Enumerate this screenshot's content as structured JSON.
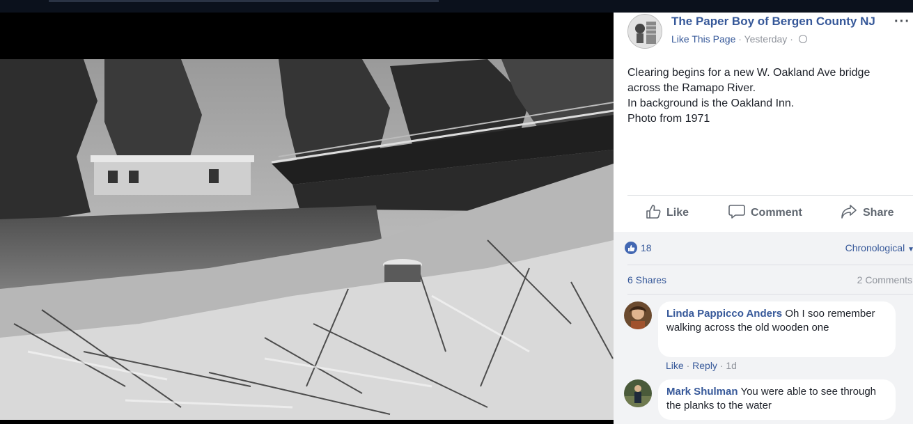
{
  "post": {
    "page_name": "The Paper Boy of Bergen County NJ",
    "like_page": "Like This Page",
    "separator": " · ",
    "time": "Yesterday",
    "caption_lines": [
      "Clearing begins for a new W. Oakland Ave bridge",
      "across the Ramapo River.",
      "In background is the Oakland Inn.",
      "Photo from 1971"
    ]
  },
  "actions": {
    "like": "Like",
    "comment": "Comment",
    "share": "Share"
  },
  "stats": {
    "reactions": "18",
    "order": "Chronological",
    "shares": "6 Shares",
    "comments": "2 Comments"
  },
  "comments": [
    {
      "author": "Linda Pappicco Anders",
      "text": "Oh I soo remember walking across the old wooden one",
      "like": "Like",
      "reply": "Reply",
      "age": "1d"
    },
    {
      "author": "Mark Shulman",
      "text": "You were able to see through the planks to the water"
    }
  ],
  "colors": {
    "link_blue": "#365899",
    "reaction_blue": "#4267b2",
    "meta_gray": "#90949c"
  },
  "icons": [
    "globe-icon",
    "more-icon",
    "thumbs-up-icon",
    "comment-icon",
    "share-icon",
    "like-reaction-icon",
    "dropdown-caret-icon"
  ]
}
